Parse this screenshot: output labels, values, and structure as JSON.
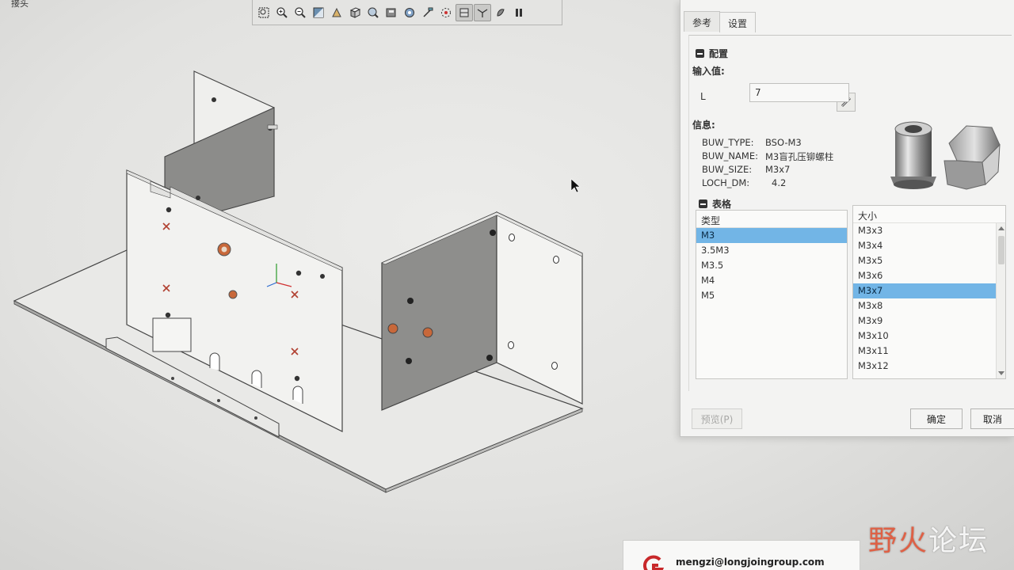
{
  "menu": {
    "tab_label": "接头"
  },
  "toolbar": {
    "icons": [
      "zoom-window-icon",
      "zoom-in-icon",
      "zoom-out-icon",
      "shade-icon",
      "orient-icon",
      "view-box-icon",
      "saved-views-icon",
      "display-style-icon",
      "layers-icon",
      "annotation-icon",
      "spin-center-icon",
      "datum-display-icon",
      "csys-display-icon",
      "appearance-icon",
      "pause-icon"
    ]
  },
  "dialog": {
    "tabs": [
      "参考",
      "设置"
    ],
    "selected_tab": "设置",
    "config": {
      "title": "配置",
      "input_label": "输入值:",
      "field_label": "L",
      "field_value": "7"
    },
    "info": {
      "title": "信息:",
      "rows": [
        {
          "key": "BUW_TYPE:",
          "value": "BSO-M3"
        },
        {
          "key": "BUW_NAME:",
          "value": "M3盲孔压铆螺柱"
        },
        {
          "key": "BUW_SIZE:",
          "value": "M3x7"
        },
        {
          "key": "LOCH_DM:",
          "value": "4.2"
        }
      ]
    },
    "table": {
      "title": "表格",
      "type_header": "类型",
      "types": [
        "M3",
        "3.5M3",
        "M3.5",
        "M4",
        "M5"
      ],
      "selected_type": "M3",
      "size_header": "大小",
      "sizes": [
        "M3x3",
        "M3x4",
        "M3x5",
        "M3x6",
        "M3x7",
        "M3x8",
        "M3x9",
        "M3x10",
        "M3x11",
        "M3x12"
      ],
      "selected_size": "M3x7"
    },
    "buttons": {
      "preview": "预览(P)",
      "ok": "确定",
      "cancel": "取消"
    }
  },
  "email_card": {
    "email": "mengzi@longjoingroup.com"
  },
  "watermark": {
    "part1": "野",
    "part2": "火",
    "part3": "论坛"
  },
  "colors": {
    "selection": "#72b5e6",
    "hole_copper": "#c8683a",
    "panel_dark": "#8c8c8a"
  }
}
